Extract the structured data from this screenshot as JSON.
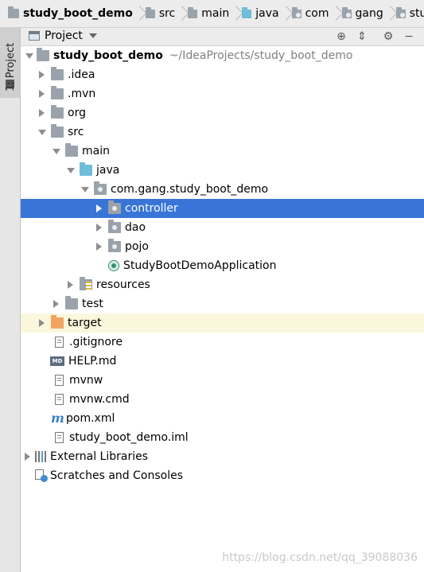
{
  "breadcrumb": [
    {
      "label": "study_boot_demo",
      "icon": "module-icon"
    },
    {
      "label": "src",
      "icon": "folder-icon"
    },
    {
      "label": "main",
      "icon": "folder-icon"
    },
    {
      "label": "java",
      "icon": "source-folder-icon"
    },
    {
      "label": "com",
      "icon": "package-icon"
    },
    {
      "label": "gang",
      "icon": "package-icon"
    },
    {
      "label": "study_b",
      "icon": "package-icon"
    }
  ],
  "side_tab": {
    "label": "1: Project"
  },
  "project_header": {
    "title": "Project"
  },
  "tree": {
    "root": {
      "label": "study_boot_demo",
      "path": "~/IdeaProjects/study_boot_demo"
    },
    "idea": ".idea",
    "mvn": ".mvn",
    "org": "org",
    "src": "src",
    "main": "main",
    "java": "java",
    "package": "com.gang.study_boot_demo",
    "controller": "controller",
    "dao": "dao",
    "pojo": "pojo",
    "app": "StudyBootDemoApplication",
    "resources": "resources",
    "test": "test",
    "target": "target",
    "gitignore": ".gitignore",
    "help": "HELP.md",
    "mvnw": "mvnw",
    "mvnwcmd": "mvnw.cmd",
    "pom": "pom.xml",
    "iml": "study_boot_demo.iml",
    "external": "External Libraries",
    "scratches": "Scratches and Consoles"
  },
  "icon_labels": {
    "md": "MD",
    "maven": "m"
  },
  "watermark": "https://blog.csdn.net/qq_39088036",
  "colors": {
    "selection": "#3875d6",
    "highlight": "#fbf7dc",
    "path": "#808080"
  }
}
